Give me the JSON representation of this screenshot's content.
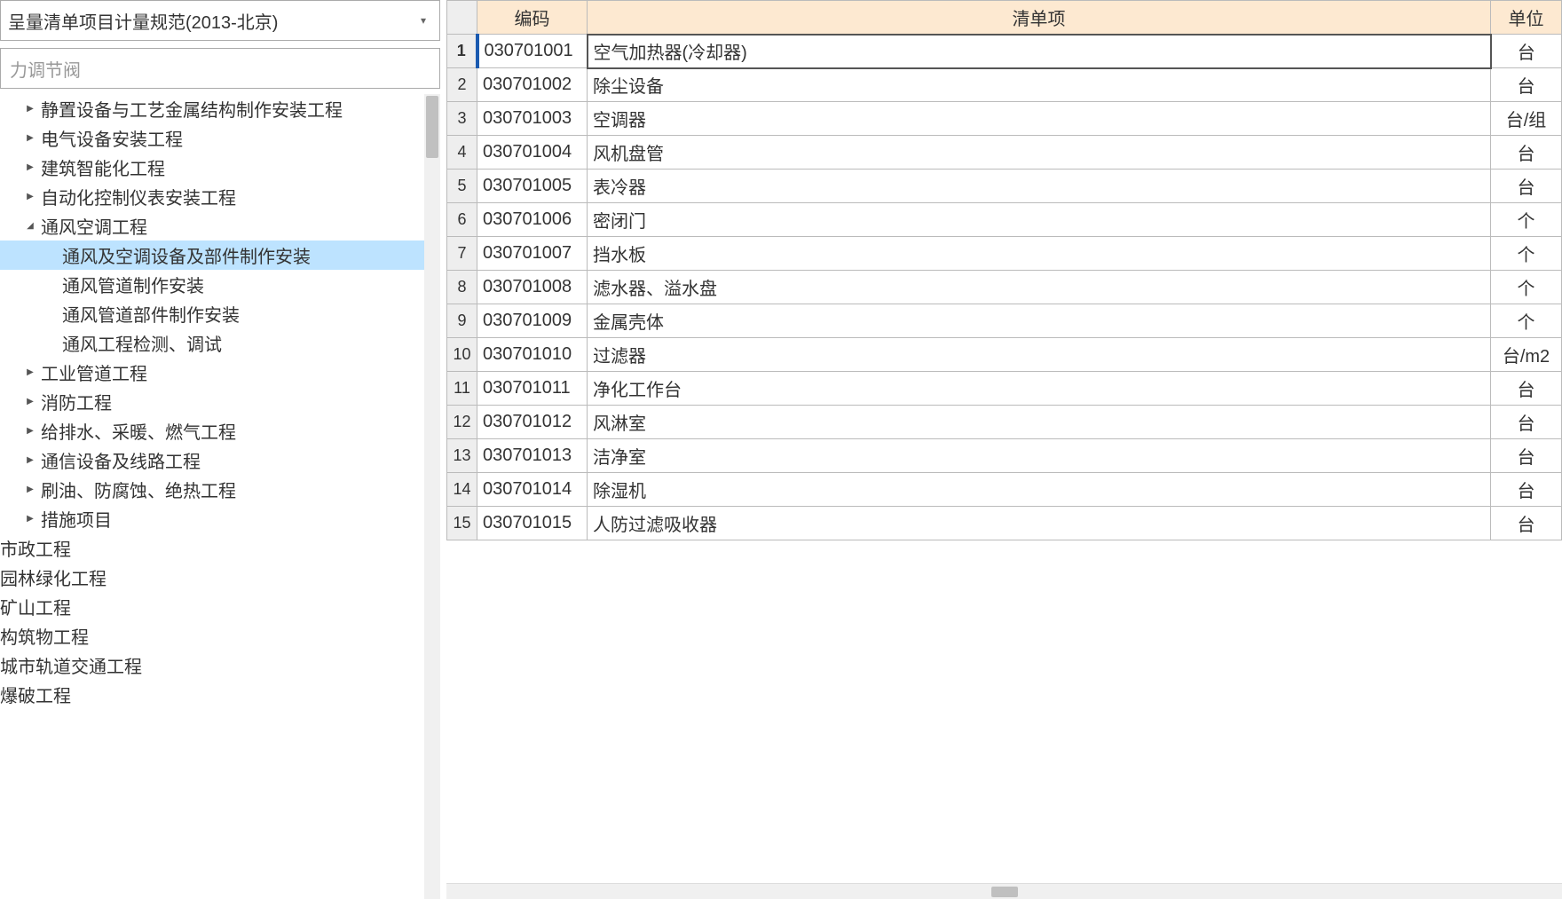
{
  "dropdown": {
    "text": "呈量清单项目计量规范(2013-北京)"
  },
  "search": {
    "placeholder": "力调节阀"
  },
  "tree": [
    {
      "level": 1,
      "caret": "right",
      "label": "静置设备与工艺金属结构制作安装工程",
      "selected": false
    },
    {
      "level": 1,
      "caret": "right",
      "label": "电气设备安装工程",
      "selected": false
    },
    {
      "level": 1,
      "caret": "right",
      "label": "建筑智能化工程",
      "selected": false
    },
    {
      "level": 1,
      "caret": "right",
      "label": "自动化控制仪表安装工程",
      "selected": false
    },
    {
      "level": 1,
      "caret": "down",
      "label": "通风空调工程",
      "selected": false
    },
    {
      "level": 2,
      "caret": "",
      "label": "通风及空调设备及部件制作安装",
      "selected": true
    },
    {
      "level": 2,
      "caret": "",
      "label": "通风管道制作安装",
      "selected": false
    },
    {
      "level": 2,
      "caret": "",
      "label": "通风管道部件制作安装",
      "selected": false
    },
    {
      "level": 2,
      "caret": "",
      "label": "通风工程检测、调试",
      "selected": false
    },
    {
      "level": 1,
      "caret": "right",
      "label": "工业管道工程",
      "selected": false
    },
    {
      "level": 1,
      "caret": "right",
      "label": "消防工程",
      "selected": false
    },
    {
      "level": 1,
      "caret": "right",
      "label": "给排水、采暖、燃气工程",
      "selected": false
    },
    {
      "level": 1,
      "caret": "right",
      "label": "通信设备及线路工程",
      "selected": false
    },
    {
      "level": 1,
      "caret": "right",
      "label": "刷油、防腐蚀、绝热工程",
      "selected": false
    },
    {
      "level": 1,
      "caret": "right",
      "label": "措施项目",
      "selected": false
    },
    {
      "level": 0,
      "caret": "",
      "label": "市政工程",
      "selected": false
    },
    {
      "level": 0,
      "caret": "",
      "label": "园林绿化工程",
      "selected": false
    },
    {
      "level": 0,
      "caret": "",
      "label": "矿山工程",
      "selected": false
    },
    {
      "level": 0,
      "caret": "",
      "label": "构筑物工程",
      "selected": false
    },
    {
      "level": 0,
      "caret": "",
      "label": "城市轨道交通工程",
      "selected": false
    },
    {
      "level": 0,
      "caret": "",
      "label": "爆破工程",
      "selected": false
    }
  ],
  "grid": {
    "headers": {
      "code": "编码",
      "item": "清单项",
      "unit": "单位"
    },
    "rows": [
      {
        "n": "1",
        "code": "030701001",
        "item": "空气加热器(冷却器)",
        "unit": "台",
        "selected": true
      },
      {
        "n": "2",
        "code": "030701002",
        "item": "除尘设备",
        "unit": "台",
        "selected": false
      },
      {
        "n": "3",
        "code": "030701003",
        "item": "空调器",
        "unit": "台/组",
        "selected": false
      },
      {
        "n": "4",
        "code": "030701004",
        "item": "风机盘管",
        "unit": "台",
        "selected": false
      },
      {
        "n": "5",
        "code": "030701005",
        "item": "表冷器",
        "unit": "台",
        "selected": false
      },
      {
        "n": "6",
        "code": "030701006",
        "item": "密闭门",
        "unit": "个",
        "selected": false
      },
      {
        "n": "7",
        "code": "030701007",
        "item": "挡水板",
        "unit": "个",
        "selected": false
      },
      {
        "n": "8",
        "code": "030701008",
        "item": "滤水器、溢水盘",
        "unit": "个",
        "selected": false
      },
      {
        "n": "9",
        "code": "030701009",
        "item": "金属壳体",
        "unit": "个",
        "selected": false
      },
      {
        "n": "10",
        "code": "030701010",
        "item": "过滤器",
        "unit": "台/m2",
        "selected": false
      },
      {
        "n": "11",
        "code": "030701011",
        "item": "净化工作台",
        "unit": "台",
        "selected": false
      },
      {
        "n": "12",
        "code": "030701012",
        "item": "风淋室",
        "unit": "台",
        "selected": false
      },
      {
        "n": "13",
        "code": "030701013",
        "item": "洁净室",
        "unit": "台",
        "selected": false
      },
      {
        "n": "14",
        "code": "030701014",
        "item": "除湿机",
        "unit": "台",
        "selected": false
      },
      {
        "n": "15",
        "code": "030701015",
        "item": "人防过滤吸收器",
        "unit": "台",
        "selected": false
      }
    ]
  }
}
